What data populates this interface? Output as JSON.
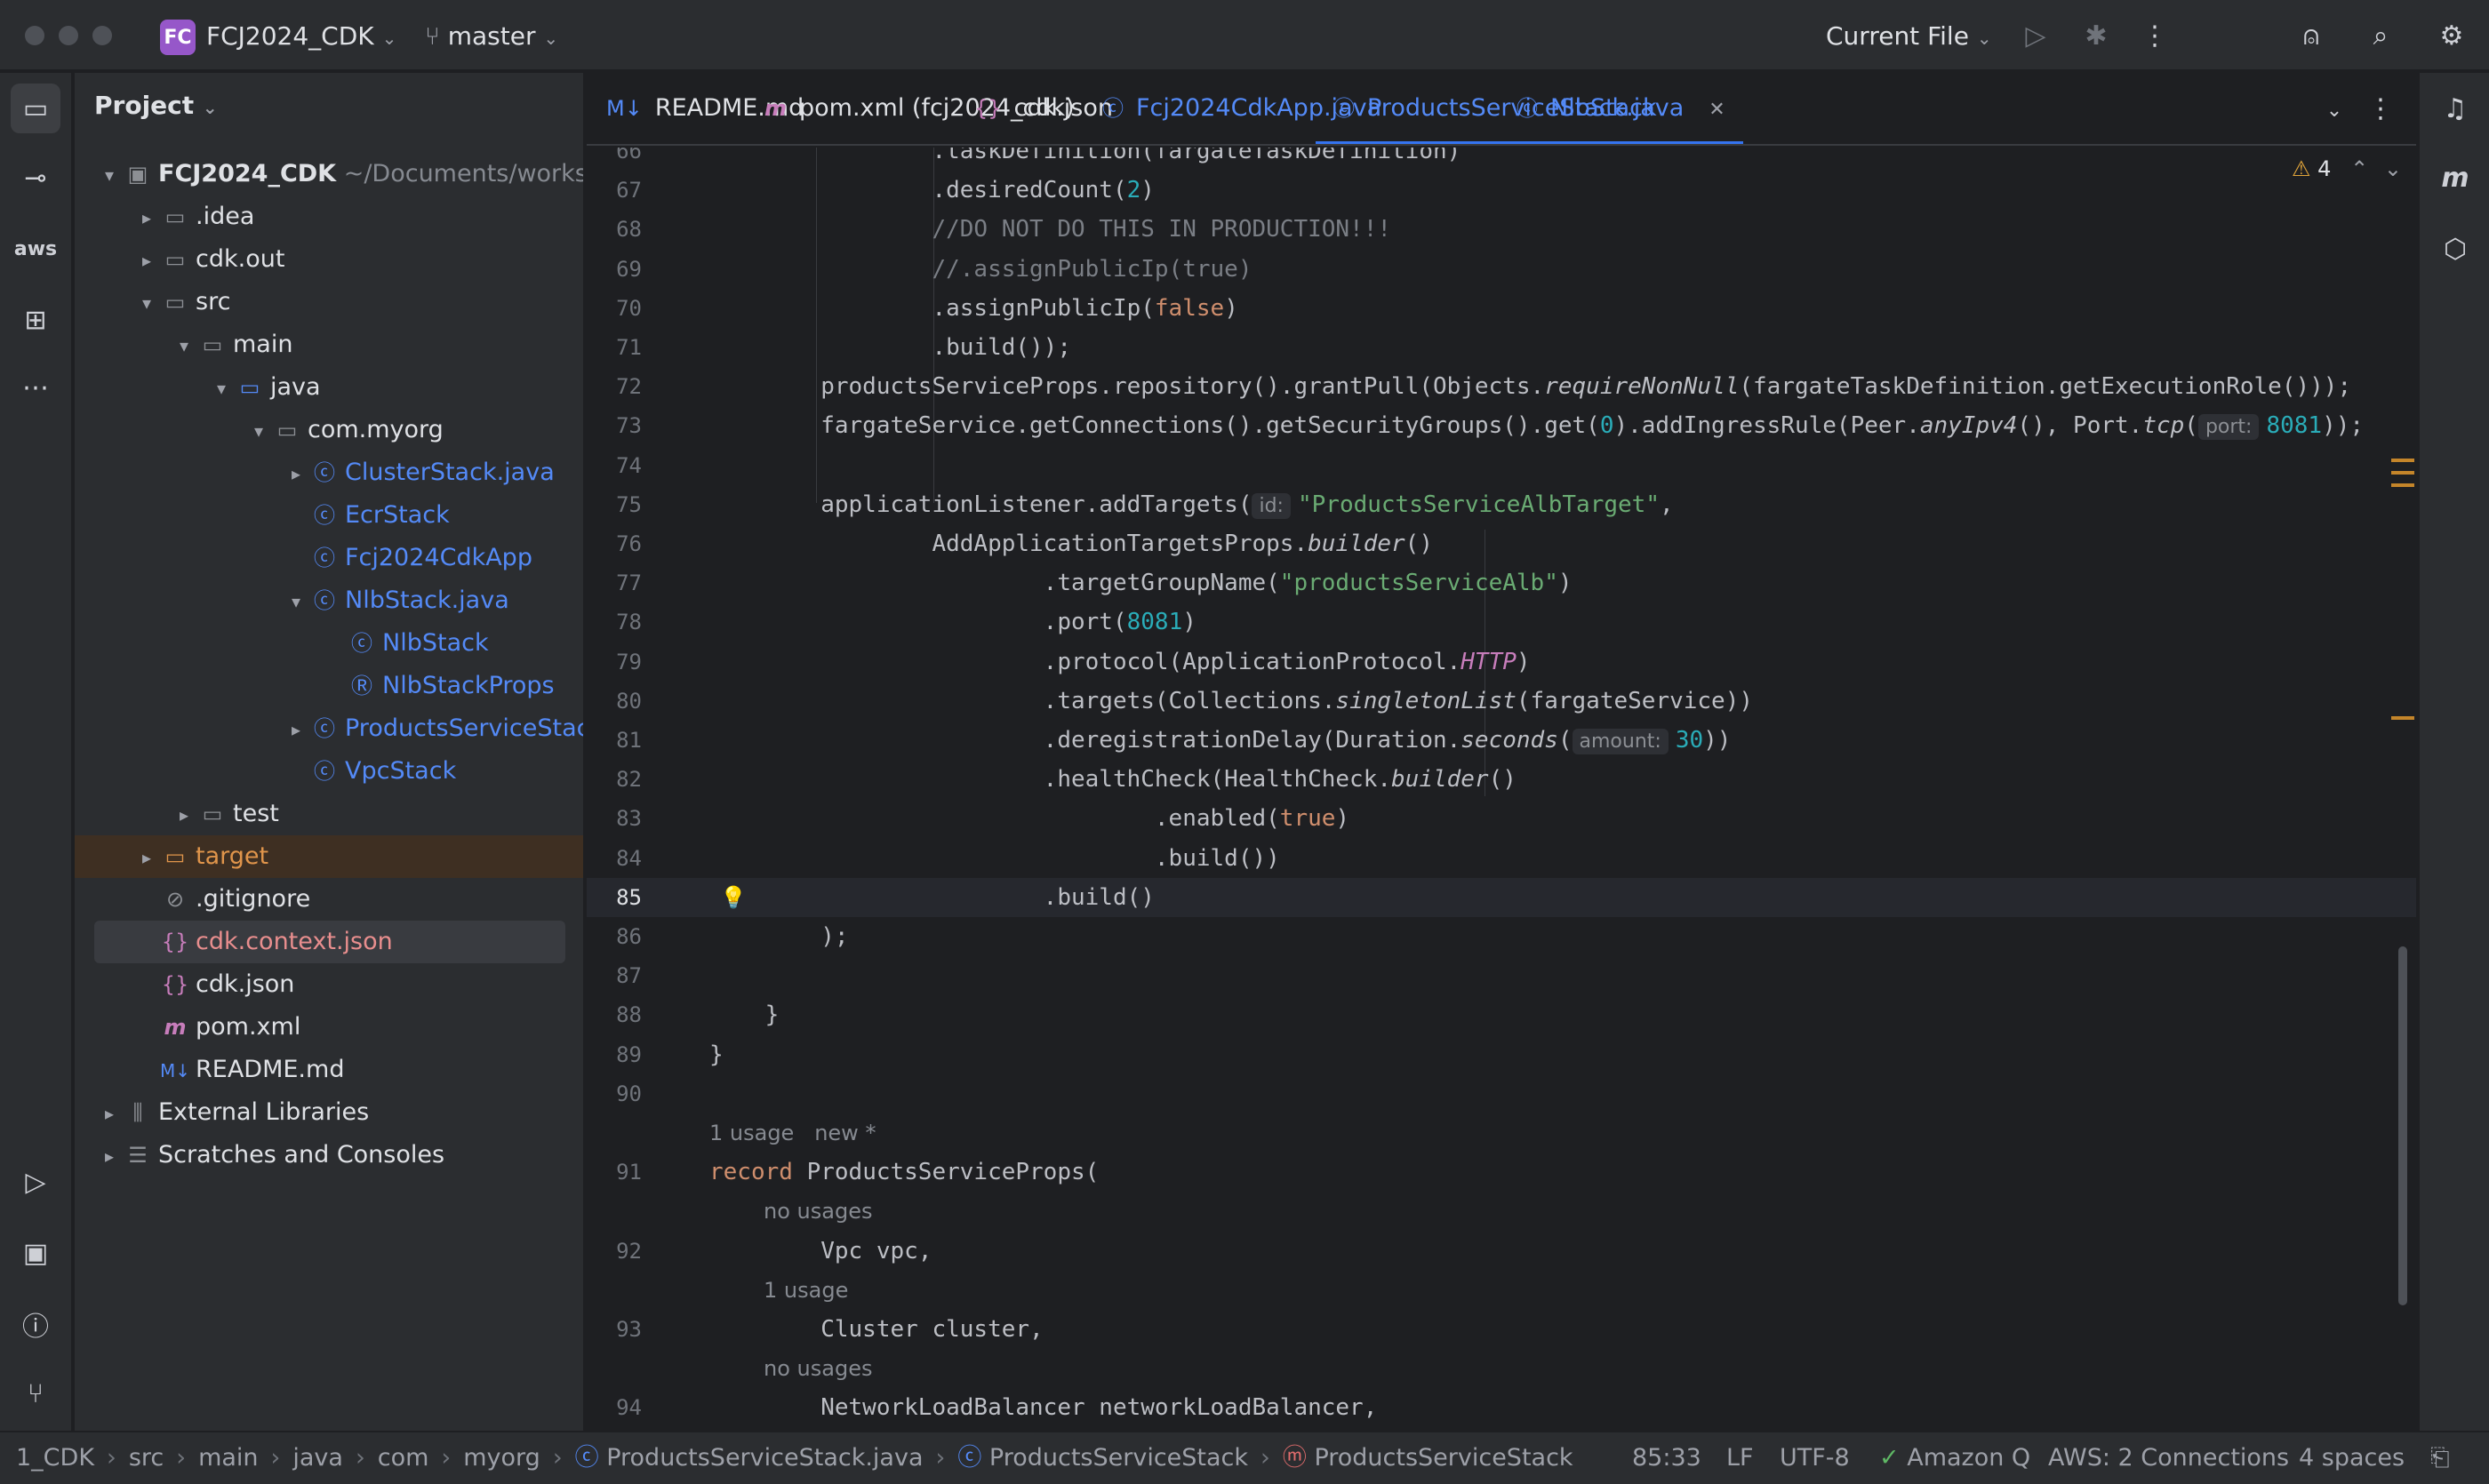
{
  "titlebar": {
    "project_badge": "FC",
    "project_name": "FCJ2024_CDK",
    "branch": "master",
    "run_config": "Current File"
  },
  "left_strip": {
    "icons": [
      "folder-icon",
      "commit-icon",
      "aws-icon",
      "structure-icon",
      "more-icon",
      "run-icon",
      "terminal-icon",
      "problems-icon",
      "git-icon"
    ],
    "aws_label": "aws"
  },
  "right_strip": {
    "icons": [
      "notifications-icon",
      "maven-icon",
      "aws-toolkit-icon"
    ],
    "maven_label": "m"
  },
  "project_panel": {
    "title": "Project",
    "tree": [
      {
        "label": "FCJ2024_CDK",
        "suffix": "~/Documents/workshop",
        "depth": 0,
        "arrow": "▾",
        "icon": "module"
      },
      {
        "label": ".idea",
        "depth": 1,
        "arrow": "▸",
        "icon": "folder"
      },
      {
        "label": "cdk.out",
        "depth": 1,
        "arrow": "▸",
        "icon": "folder"
      },
      {
        "label": "src",
        "depth": 1,
        "arrow": "▾",
        "icon": "folder"
      },
      {
        "label": "main",
        "depth": 2,
        "arrow": "▾",
        "icon": "folder"
      },
      {
        "label": "java",
        "depth": 3,
        "arrow": "▾",
        "icon": "folder-blue"
      },
      {
        "label": "com.myorg",
        "depth": 4,
        "arrow": "▾",
        "icon": "package"
      },
      {
        "label": "ClusterStack.java",
        "depth": 5,
        "arrow": "▸",
        "icon": "class"
      },
      {
        "label": "EcrStack",
        "depth": 5,
        "arrow": "",
        "icon": "class"
      },
      {
        "label": "Fcj2024CdkApp",
        "depth": 5,
        "arrow": "",
        "icon": "class"
      },
      {
        "label": "NlbStack.java",
        "depth": 5,
        "arrow": "▾",
        "icon": "class"
      },
      {
        "label": "NlbStack",
        "depth": 6,
        "arrow": "",
        "icon": "class"
      },
      {
        "label": "NlbStackProps",
        "depth": 6,
        "arrow": "",
        "icon": "record"
      },
      {
        "label": "ProductsServiceStack.java",
        "depth": 5,
        "arrow": "▸",
        "icon": "class"
      },
      {
        "label": "VpcStack",
        "depth": 5,
        "arrow": "",
        "icon": "class"
      },
      {
        "label": "test",
        "depth": 2,
        "arrow": "▸",
        "icon": "folder"
      },
      {
        "label": "target",
        "depth": 1,
        "arrow": "▸",
        "icon": "folder-orange"
      },
      {
        "label": ".gitignore",
        "depth": 1,
        "arrow": "",
        "icon": "ignore"
      },
      {
        "label": "cdk.context.json",
        "depth": 1,
        "arrow": "",
        "icon": "json"
      },
      {
        "label": "cdk.json",
        "depth": 1,
        "arrow": "",
        "icon": "json"
      },
      {
        "label": "pom.xml",
        "depth": 1,
        "arrow": "",
        "icon": "maven"
      },
      {
        "label": "README.md",
        "depth": 1,
        "arrow": "",
        "icon": "markdown"
      },
      {
        "label": "External Libraries",
        "depth": 0,
        "arrow": "▸",
        "icon": "library"
      },
      {
        "label": "Scratches and Consoles",
        "depth": 0,
        "arrow": "▸",
        "icon": "scratch"
      }
    ]
  },
  "tabs": [
    {
      "label": "README.md",
      "icon": "M↓"
    },
    {
      "label": "pom.xml (fcj2024_cdk)",
      "icon": "m"
    },
    {
      "label": "cdk.json",
      "icon": "{}"
    },
    {
      "label": "Fcj2024CdkApp.java",
      "icon": "ⓒ"
    },
    {
      "label": "ProductsServiceStack.java",
      "icon": "ⓒ",
      "close": "✕"
    },
    {
      "label": "NlbStack",
      "icon": "ⓒ"
    }
  ],
  "editor": {
    "warnings": "4",
    "lines": [
      {
        "n": "66",
        "tokens": [
          {
            "t": "                .taskDefinition(fargateTaskDefinition)"
          }
        ]
      },
      {
        "n": "67",
        "tokens": [
          {
            "t": "                .desiredCount("
          },
          {
            "t": "2",
            "c": "num"
          },
          {
            "t": ")"
          }
        ]
      },
      {
        "n": "68",
        "tokens": [
          {
            "t": "                //DO NOT DO THIS IN PRODUCTION!!!",
            "c": "cm"
          }
        ]
      },
      {
        "n": "69",
        "tokens": [
          {
            "t": "                //.assignPublicIp(true)",
            "c": "cm"
          }
        ]
      },
      {
        "n": "70",
        "tokens": [
          {
            "t": "                .assignPublicIp("
          },
          {
            "t": "false",
            "c": "kw"
          },
          {
            "t": ")"
          }
        ]
      },
      {
        "n": "71",
        "tokens": [
          {
            "t": "                .build());"
          }
        ]
      },
      {
        "n": "72",
        "tokens": [
          {
            "t": "        productsServiceProps.repository().grantPull(Objects."
          },
          {
            "t": "requireNonNull",
            "c": "it"
          },
          {
            "t": "(fargateTaskDefinition.getExecutionRole()));"
          }
        ]
      },
      {
        "n": "73",
        "tokens": [
          {
            "t": "        fargateService.getConnections().getSecurityGroups().get("
          },
          {
            "t": "0",
            "c": "num"
          },
          {
            "t": ").addIngressRule(Peer."
          },
          {
            "t": "anyIpv4",
            "c": "it"
          },
          {
            "t": "(), Port."
          },
          {
            "t": "tcp",
            "c": "it"
          },
          {
            "t": "("
          },
          {
            "t": "port:",
            "c": "inlay"
          },
          {
            "t": "8081",
            "c": "num"
          },
          {
            "t": "));"
          }
        ]
      },
      {
        "n": "74",
        "tokens": [
          {
            "t": ""
          }
        ]
      },
      {
        "n": "75",
        "tokens": [
          {
            "t": "        applicationListener.addTargets("
          },
          {
            "t": "id:",
            "c": "inlay"
          },
          {
            "t": "\"ProductsServiceAlbTarget\"",
            "c": "str"
          },
          {
            "t": ","
          }
        ]
      },
      {
        "n": "76",
        "tokens": [
          {
            "t": "                AddApplicationTargetsProps."
          },
          {
            "t": "builder",
            "c": "it"
          },
          {
            "t": "()"
          }
        ]
      },
      {
        "n": "77",
        "tokens": [
          {
            "t": "                        .targetGroupName("
          },
          {
            "t": "\"productsServiceAlb\"",
            "c": "str"
          },
          {
            "t": ")"
          }
        ]
      },
      {
        "n": "78",
        "tokens": [
          {
            "t": "                        .port("
          },
          {
            "t": "8081",
            "c": "num"
          },
          {
            "t": ")"
          }
        ]
      },
      {
        "n": "79",
        "tokens": [
          {
            "t": "                        .protocol(ApplicationProtocol."
          },
          {
            "t": "HTTP",
            "c": "cns"
          },
          {
            "t": ")"
          }
        ]
      },
      {
        "n": "80",
        "tokens": [
          {
            "t": "                        .targets(Collections."
          },
          {
            "t": "singletonList",
            "c": "it"
          },
          {
            "t": "(fargateService))"
          }
        ]
      },
      {
        "n": "81",
        "tokens": [
          {
            "t": "                        .deregistrationDelay(Duration."
          },
          {
            "t": "seconds",
            "c": "it"
          },
          {
            "t": "("
          },
          {
            "t": "amount:",
            "c": "inlay"
          },
          {
            "t": "30",
            "c": "num"
          },
          {
            "t": "))"
          }
        ]
      },
      {
        "n": "82",
        "tokens": [
          {
            "t": "                        .healthCheck(HealthCheck."
          },
          {
            "t": "builder",
            "c": "it"
          },
          {
            "t": "()"
          }
        ]
      },
      {
        "n": "83",
        "tokens": [
          {
            "t": "                                .enabled("
          },
          {
            "t": "true",
            "c": "kw"
          },
          {
            "t": ")"
          }
        ]
      },
      {
        "n": "84",
        "tokens": [
          {
            "t": "                                .build())"
          }
        ]
      },
      {
        "n": "85",
        "tokens": [
          {
            "t": "                        .build()"
          }
        ],
        "current": true
      },
      {
        "n": "86",
        "tokens": [
          {
            "t": "        );"
          }
        ]
      },
      {
        "n": "87",
        "tokens": [
          {
            "t": ""
          }
        ]
      },
      {
        "n": "88",
        "tokens": [
          {
            "t": "    }"
          }
        ]
      },
      {
        "n": "89",
        "tokens": [
          {
            "t": "}"
          }
        ]
      },
      {
        "n": "90",
        "tokens": [
          {
            "t": ""
          }
        ]
      },
      {
        "n": "",
        "hint": "1 usage   new *"
      },
      {
        "n": "91",
        "tokens": [
          {
            "t": "record",
            "c": "kw"
          },
          {
            "t": " ProductsServiceProps("
          }
        ]
      },
      {
        "n": "",
        "hint": "        no usages"
      },
      {
        "n": "92",
        "tokens": [
          {
            "t": "        Vpc vpc,"
          }
        ]
      },
      {
        "n": "",
        "hint": "        1 usage"
      },
      {
        "n": "93",
        "tokens": [
          {
            "t": "        Cluster cluster,"
          }
        ]
      },
      {
        "n": "",
        "hint": "        no usages"
      },
      {
        "n": "94",
        "tokens": [
          {
            "t": "        NetworkLoadBalancer networkLoadBalancer,"
          }
        ]
      }
    ]
  },
  "statusbar": {
    "breadcrumbs": [
      "1_CDK",
      "src",
      "main",
      "java",
      "com",
      "myorg",
      "ProductsServiceStack.java",
      "ProductsServiceStack",
      "ProductsServiceStack"
    ],
    "position": "85:33",
    "line_sep": "LF",
    "encoding": "UTF-8",
    "amazon_q": "Amazon Q",
    "aws": "AWS: 2 Connections",
    "indent": "4 spaces"
  }
}
